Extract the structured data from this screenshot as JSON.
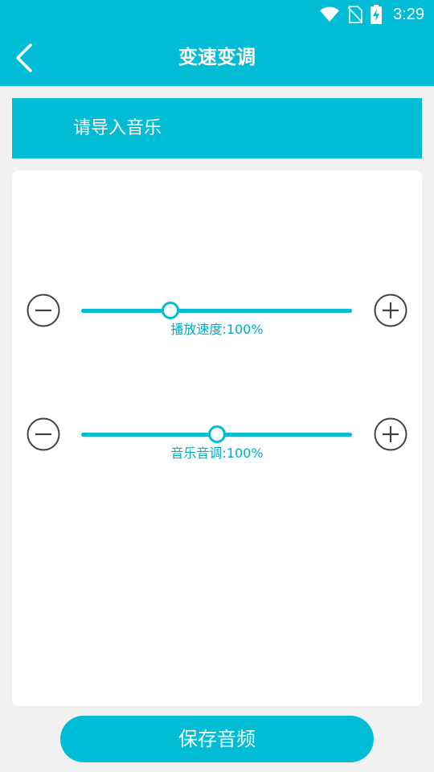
{
  "status_bar": {
    "time": "3:29",
    "icons": [
      "wifi-icon",
      "no-sim-icon",
      "battery-charging-icon"
    ]
  },
  "header": {
    "title": "变速变调",
    "back_icon": "chevron-left-icon"
  },
  "import_bar": {
    "label": "请导入音乐"
  },
  "controls": [
    {
      "id": "speed",
      "label": "播放速度:100%",
      "slider_fraction": 0.33,
      "decrease_icon": "minus-circle-icon",
      "increase_icon": "plus-circle-icon"
    },
    {
      "id": "pitch",
      "label": "音乐音调:100%",
      "slider_fraction": 0.5,
      "decrease_icon": "minus-circle-icon",
      "increase_icon": "plus-circle-icon"
    }
  ],
  "save_button": {
    "label": "保存音频"
  },
  "colors": {
    "accent": "#00bcd4",
    "label_text": "#00aec6",
    "background": "#f1f1f1",
    "card": "#ffffff",
    "icon_stroke": "#424242"
  }
}
